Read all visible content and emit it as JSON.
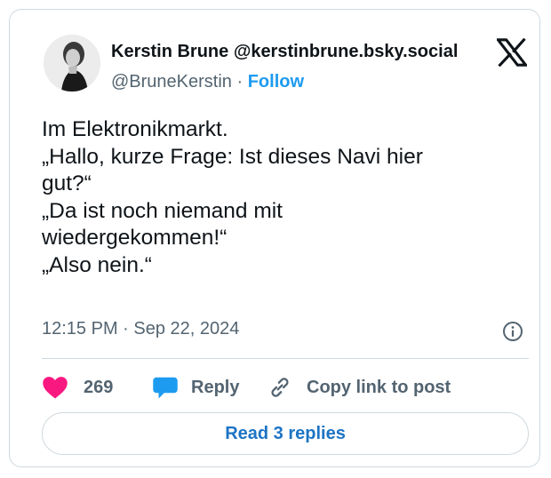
{
  "author": {
    "display_name": "Kerstin Brune",
    "bsky_handle": "@kerstinbrune.bsky.social",
    "x_handle": "@BruneKerstin",
    "separator": "·",
    "follow_label": "Follow"
  },
  "post": {
    "lines": [
      "Im Elektronikmarkt.",
      "„Hallo, kurze Frage: Ist dieses Navi hier",
      "gut?“",
      "„Da ist noch niemand mit",
      "wiedergekommen!“",
      "„Also nein.“"
    ],
    "timestamp": "12:15 PM · Sep 22, 2024"
  },
  "actions": {
    "like_count": "269",
    "reply_label": "Reply",
    "copy_link_label": "Copy link to post",
    "read_replies_label": "Read 3 replies"
  },
  "icons": {
    "logo": "x-logo-icon",
    "info": "info-icon",
    "like": "heart-icon",
    "reply": "speech-bubble-icon",
    "copy_link": "link-icon"
  },
  "colors": {
    "accent": "#1d9bf0",
    "heart": "#f91880",
    "muted": "#536471",
    "border": "#cfd9de"
  }
}
